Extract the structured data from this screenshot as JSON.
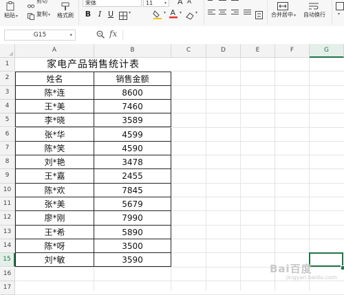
{
  "ribbon": {
    "cut_label": "剪切",
    "paste_label": "粘贴",
    "copy_label": "复制",
    "format_painter_label": "格式刷",
    "font_name": "宋体",
    "font_size": "11",
    "bold": "B",
    "italic": "I",
    "underline": "U",
    "merge_center_label": "合并居中",
    "wrap_text_label": "自动换行",
    "grow_font": "A",
    "shrink_font": "A"
  },
  "formula_bar": {
    "name_box": "G15",
    "fx_label": "fx",
    "formula_value": ""
  },
  "columns": [
    "A",
    "B",
    "C",
    "D",
    "E",
    "F",
    "G"
  ],
  "active_column": "G",
  "rows": [
    "1",
    "2",
    "3",
    "4",
    "5",
    "6",
    "7",
    "8",
    "9",
    "10",
    "11",
    "12",
    "13",
    "14",
    "15",
    "16",
    "17"
  ],
  "active_row": "15",
  "sheet": {
    "title": "家电产品销售统计表",
    "header_name": "姓名",
    "header_amount": "销售金额",
    "records": [
      {
        "name": "陈*连",
        "amount": "8600"
      },
      {
        "name": "王*美",
        "amount": "7460"
      },
      {
        "name": "李*晓",
        "amount": "3589"
      },
      {
        "name": "张*华",
        "amount": "4599"
      },
      {
        "name": "陈*笑",
        "amount": "4590"
      },
      {
        "name": "刘*艳",
        "amount": "3478"
      },
      {
        "name": "王*嘉",
        "amount": "2455"
      },
      {
        "name": "陈*欢",
        "amount": "7845"
      },
      {
        "name": "张*美",
        "amount": "5679"
      },
      {
        "name": "廖*刚",
        "amount": "7990"
      },
      {
        "name": "王*希",
        "amount": "5890"
      },
      {
        "name": "陈*呀",
        "amount": "3500"
      },
      {
        "name": "刘*敏",
        "amount": "3590"
      }
    ]
  },
  "colors": {
    "accent": "#217346",
    "font_color_bar": "#e03030",
    "fill_color_bar": "#f5c400"
  },
  "watermark": {
    "brand": "Bai百度",
    "sub": "jingyan.baidu.com"
  }
}
